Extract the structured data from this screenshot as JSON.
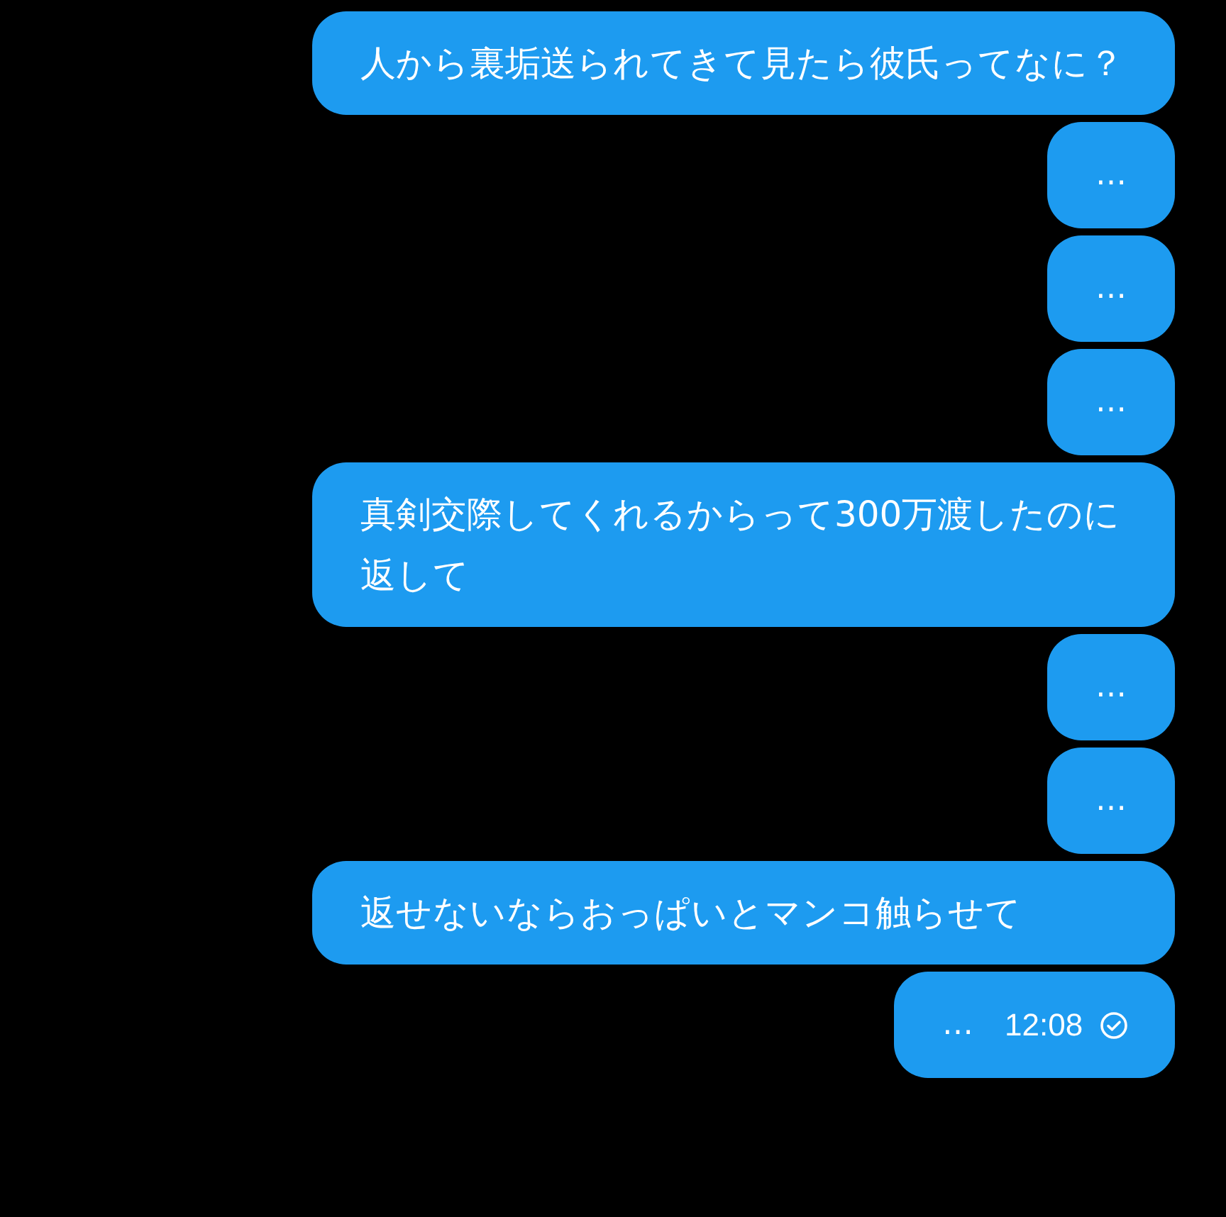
{
  "messages": [
    {
      "kind": "text",
      "text": "人から裏垢送られてきて見たら彼氏ってなに？"
    },
    {
      "kind": "dots",
      "text": "…"
    },
    {
      "kind": "dots",
      "text": "…"
    },
    {
      "kind": "dots",
      "text": "…"
    },
    {
      "kind": "text",
      "text": "真剣交際してくれるからって300万渡したのに返して"
    },
    {
      "kind": "dots",
      "text": "…"
    },
    {
      "kind": "dots",
      "text": "…"
    },
    {
      "kind": "text",
      "text": "返せないならおっぱいとマンコ触らせて"
    },
    {
      "kind": "status",
      "text": "…",
      "time": "12:08",
      "read": true
    }
  ]
}
